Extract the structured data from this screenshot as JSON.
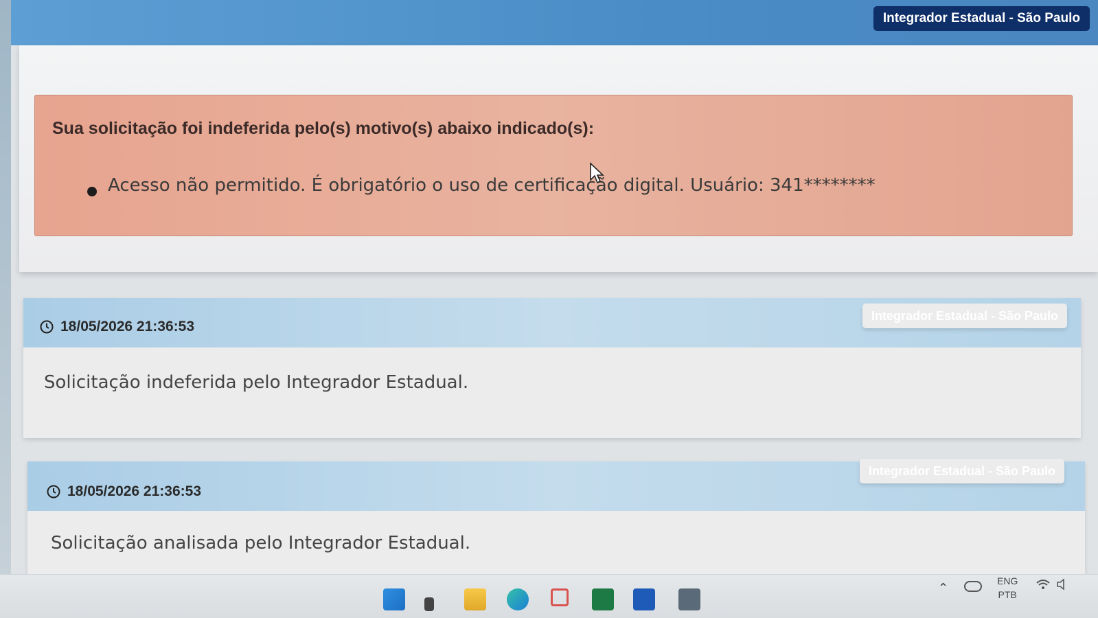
{
  "header": {
    "badge": "Integrador Estadual - São Paulo"
  },
  "alert": {
    "title": "Sua solicitação foi indeferida pelo(s) motivo(s) abaixo indicado(s):",
    "items": [
      "Acesso não permitido. É obrigatório o uso de certificação digital. Usuário: 341********"
    ]
  },
  "history": [
    {
      "timestamp": "18/05/2026 21:36:53",
      "source": "Integrador Estadual - São Paulo",
      "message": "Solicitação indeferida pelo Integrador Estadual."
    },
    {
      "timestamp": "18/05/2026 21:36:53",
      "source": "Integrador Estadual - São Paulo",
      "message": "Solicitação analisada pelo Integrador Estadual."
    }
  ],
  "taskbar": {
    "icons": [
      "windows-start-icon",
      "search-icon",
      "file-explorer-icon",
      "edge-browser-icon",
      "snipping-tool-icon",
      "excel-icon",
      "word-icon",
      "calculator-icon"
    ],
    "tray": {
      "lang_top": "ENG",
      "lang_bottom": "PTB"
    }
  }
}
